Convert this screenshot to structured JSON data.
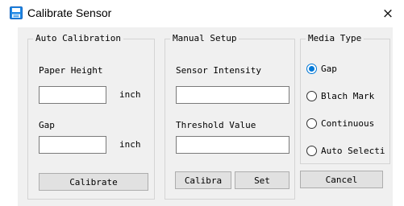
{
  "window": {
    "title": "Calibrate Sensor",
    "close_glyph": "×"
  },
  "auto_calibration": {
    "group_title": "Auto Calibration",
    "paper_height_label": "Paper Height",
    "paper_height_value": "",
    "paper_height_unit": "inch",
    "gap_label": "Gap",
    "gap_value": "",
    "gap_unit": "inch",
    "calibrate_button": "Calibrate"
  },
  "manual_setup": {
    "group_title": "Manual Setup",
    "sensor_intensity_label": "Sensor Intensity",
    "sensor_intensity_value": "",
    "threshold_label": "Threshold Value",
    "threshold_value": "",
    "calibra_button": "Calibra",
    "set_button": "Set"
  },
  "media_type": {
    "group_title": "Media Type",
    "options": [
      {
        "label": "Gap",
        "checked": true
      },
      {
        "label": "Blach Mark",
        "checked": false
      },
      {
        "label": "Continuous",
        "checked": false
      },
      {
        "label": "Auto Selecti",
        "checked": false
      }
    ],
    "cancel_button": "Cancel"
  },
  "colors": {
    "accent": "#0078d7",
    "dialog_background": "#f0f0f0",
    "button_face": "#e1e1e1"
  }
}
